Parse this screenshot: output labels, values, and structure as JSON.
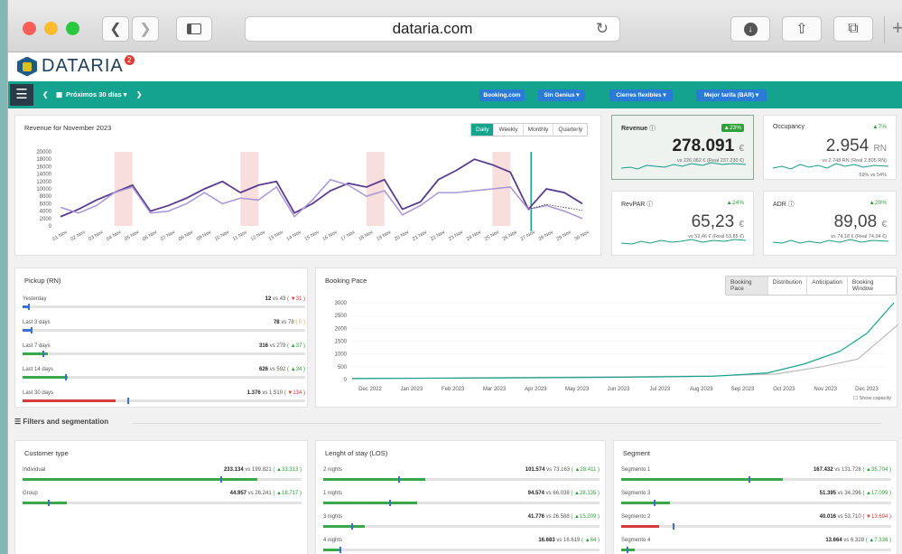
{
  "browser": {
    "url": "dataria.com"
  },
  "app": {
    "logo": "DATARIA",
    "badge": "2"
  },
  "nav": {
    "period": "Próximos 30 días",
    "booking": "Booking.com",
    "genius": "Sin Genius",
    "cierres": "Cierres flexibles",
    "tarifa": "Mejor tarifa (BAR)"
  },
  "revenue_chart": {
    "title": "Revenue for November 2023",
    "tabs": [
      "Daily",
      "Weekly",
      "Monthly",
      "Quarterly"
    ]
  },
  "chart_data": {
    "type": "line",
    "title": "Revenue for November 2023",
    "categories": [
      "01 Nov",
      "02 Nov",
      "03 Nov",
      "04 Nov",
      "05 Nov",
      "06 Nov",
      "07 Nov",
      "08 Nov",
      "09 Nov",
      "10 Nov",
      "11 Nov",
      "12 Nov",
      "13 Nov",
      "14 Nov",
      "15 Nov",
      "16 Nov",
      "17 Nov",
      "18 Nov",
      "19 Nov",
      "20 Nov",
      "21 Nov",
      "22 Nov",
      "23 Nov",
      "24 Nov",
      "25 Nov",
      "26 Nov",
      "27 Nov",
      "28 Nov",
      "29 Nov",
      "30 Nov"
    ],
    "yticks": [
      "20000",
      "18000",
      "16000",
      "14000",
      "12000",
      "10000",
      "8000",
      "6000",
      "4000",
      "2000",
      "0"
    ],
    "ylim": [
      0,
      20000
    ],
    "series": [
      {
        "values": [
          2500,
          4500,
          7000,
          9000,
          11000,
          4000,
          5500,
          7500,
          10000,
          12000,
          9000,
          11000,
          12000,
          3500,
          6000,
          9500,
          11500,
          10500,
          12500,
          4500,
          6500,
          12500,
          15000,
          18000,
          16500,
          14500,
          4500,
          10000,
          9000,
          6000
        ]
      },
      {
        "values": [
          5000,
          3500,
          5500,
          9000,
          10500,
          3500,
          4000,
          6000,
          9000,
          6000,
          7500,
          7000,
          10500,
          2500,
          7000,
          12500,
          11000,
          8000,
          9500,
          3000,
          5500,
          9000,
          9000,
          9500,
          10000,
          10500,
          4500,
          5500,
          4000,
          2000
        ]
      }
    ]
  },
  "kpis": [
    {
      "label": "Revenue",
      "change": "▲23%",
      "value": "278.091",
      "unit": "€",
      "vs": "vs 226.062 € (Real 237.230 €)"
    },
    {
      "label": "Occupancy",
      "change": "▲7%",
      "value": "2.954",
      "unit": "RN",
      "vs": "vs 2.748 RN (Real 2.805 RN)",
      "extra": "59% vs 54%"
    },
    {
      "label": "RevPAR",
      "change": "▲24%",
      "value": "65,23",
      "unit": "€",
      "vs": "vs 52,46 € (Real 53,85 €)"
    },
    {
      "label": "ADR",
      "change": "▲20%",
      "value": "89,08",
      "unit": "€",
      "vs": "vs 74,18 € (Real 74,04 €)"
    }
  ],
  "pickup": {
    "title": "Pickup (RN)",
    "rows": [
      {
        "label": "Yesterday",
        "value": "12",
        "vs": "vs 43",
        "delta": "( ▼31 )",
        "cls": "rr",
        "pct": 0.02,
        "mk": 0.02,
        "color": "#3b6fd6"
      },
      {
        "label": "Last 3 days",
        "value": "78",
        "vs": "vs 78",
        "delta": "( 0 )",
        "cls": "o",
        "pct": 0.03,
        "mk": 0.03,
        "color": "#3b6fd6"
      },
      {
        "label": "Last 7 days",
        "value": "316",
        "vs": "vs 279",
        "delta": "( ▲37 )",
        "cls": "g",
        "pct": 0.09,
        "mk": 0.07,
        "color": "#3aa84a"
      },
      {
        "label": "Last 14 days",
        "value": "626",
        "vs": "vs 592",
        "delta": "( ▲34 )",
        "cls": "g",
        "pct": 0.16,
        "mk": 0.15,
        "color": "#3aa84a"
      },
      {
        "label": "Last 30 days",
        "value": "1.376",
        "vs": "vs 1.510",
        "delta": "( ▼134 )",
        "cls": "rr",
        "pct": 0.33,
        "mk": 0.37,
        "color": "#d63a3a"
      }
    ]
  },
  "pace": {
    "title": "Booking Pace",
    "tabs": [
      "Booking Pace",
      "Distribution",
      "Anticipation",
      "Booking Window"
    ],
    "yticks": [
      "3000",
      "2500",
      "2000",
      "1500",
      "1000",
      "500",
      "0"
    ],
    "xticks": [
      "Dec 2022",
      "Jan 2023",
      "Feb 2023",
      "Mar 2023",
      "Apr 2023",
      "May 2023",
      "Jun 2023",
      "Jul 2023",
      "Aug 2023",
      "Sep 2023",
      "Oct 2023",
      "Nov 2023",
      "Dec 2023"
    ],
    "show_capacity": "Show capacity"
  },
  "filters_title": "Filters and segmentation",
  "customer": {
    "title": "Customer type",
    "rows": [
      {
        "label": "Individual",
        "value": "233.134",
        "vs": "vs 199.821",
        "delta": "( ▲33.313 )",
        "pct": 0.84,
        "mk": 0.71
      },
      {
        "label": "Group",
        "value": "44.957",
        "vs": "vs 26.241",
        "delta": "( ▲18.717 )",
        "pct": 0.16,
        "mk": 0.09
      }
    ]
  },
  "los": {
    "title": "Lenght of stay (LOS)",
    "rows": [
      {
        "label": "2 nights",
        "value": "101.574",
        "vs": "vs 73.163",
        "delta": "( ▲28.411 )",
        "pct": 0.37,
        "mk": 0.27
      },
      {
        "label": "1 nights",
        "value": "94.574",
        "vs": "vs 66.038",
        "delta": "( ▲28.135 )",
        "pct": 0.34,
        "mk": 0.24
      },
      {
        "label": "3 nights",
        "value": "41.776",
        "vs": "vs 26.588",
        "delta": "( ▲15.209 )",
        "pct": 0.15,
        "mk": 0.1
      },
      {
        "label": "4 nights",
        "value": "16.683",
        "vs": "vs 16.619",
        "delta": "( ▲64 )",
        "pct": 0.06,
        "mk": 0.06
      }
    ]
  },
  "segment": {
    "title": "Segment",
    "rows": [
      {
        "label": "Segmento 1",
        "value": "167.432",
        "vs": "vs 131.728",
        "delta": "( ▲35.704 )",
        "pct": 0.6,
        "mk": 0.47,
        "color": "#3aa84a"
      },
      {
        "label": "Segmento 3",
        "value": "51.395",
        "vs": "vs 34.296",
        "delta": "( ▲17.099 )",
        "pct": 0.18,
        "mk": 0.12,
        "color": "#3aa84a"
      },
      {
        "label": "Segmento 2",
        "value": "40.016",
        "vs": "vs 53.710",
        "delta": "( ▼13.694 )",
        "pct": 0.14,
        "mk": 0.19,
        "color": "#d63a3a"
      },
      {
        "label": "Segmento 4",
        "value": "13.664",
        "vs": "vs 6.328",
        "delta": "( ▲7.336 )",
        "pct": 0.05,
        "mk": 0.02,
        "color": "#3aa84a"
      }
    ]
  }
}
